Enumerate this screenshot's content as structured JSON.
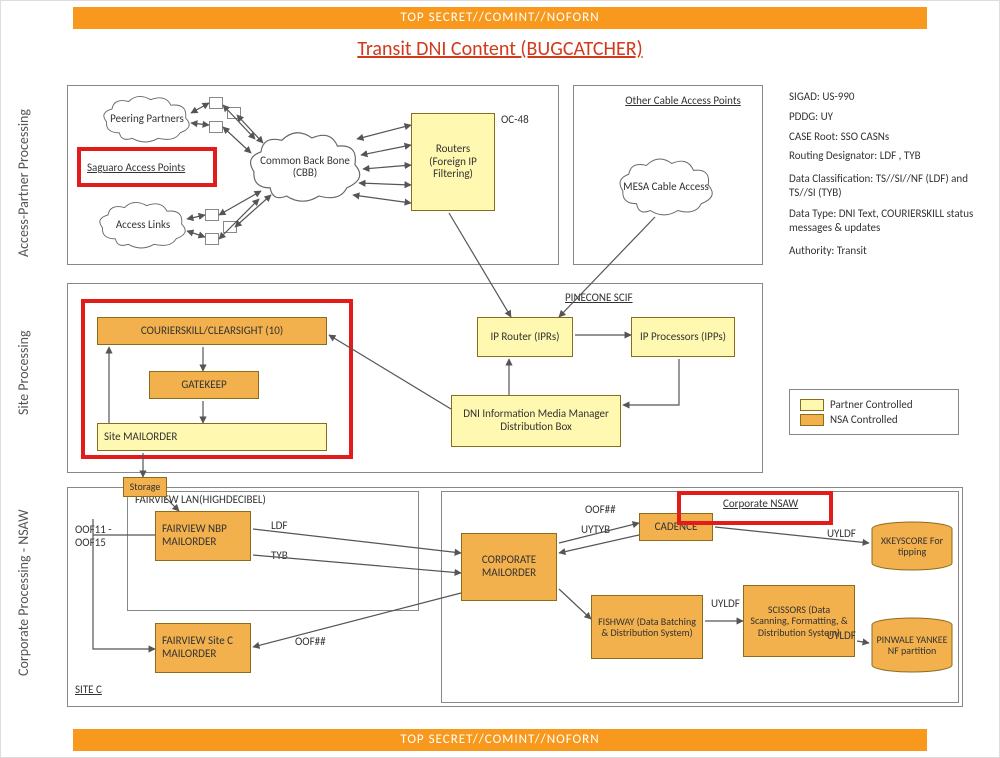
{
  "banner": "TOP SECRET//COMINT//NOFORN",
  "title": "Transit DNI Content (BUGCATCHER)",
  "sections": {
    "access": "Access-Partner Processing",
    "site": "Site Processing",
    "corp": "Corporate Processing - NSAW"
  },
  "clouds": {
    "peering": "Peering Partners",
    "access_links": "Access Links",
    "cbb": "Common Back Bone (CBB)",
    "mesa": "MESA Cable Access"
  },
  "labels": {
    "saguaro": "Saguaro Access Points",
    "other_cable": "Other Cable Access Points",
    "oc48": "OC-48",
    "pinecone": "PINECONE SCIF",
    "fairview_lan": "FAIRVIEW LAN(HIGHDECIBEL)",
    "oof_range": "OOF11 -OOF15",
    "site_c": "SITE C",
    "corp_nsaw": "Corporate NSAW",
    "ldf": "LDF",
    "tyb": "TYB",
    "oof1": "OOF##",
    "oof2": "OOF##",
    "uytyb": "UYTYB",
    "uyldf1": "UYLDF",
    "uyldf2": "UYLDF",
    "uyldf3": "UYLDF"
  },
  "nodes": {
    "routers": "Routers (Foreign IP Filtering)",
    "courierskill": "COURIERSKILL/CLEARSIGHT (10)",
    "gatekeep": "GATEKEEP",
    "site_mailorder": "Site MAILORDER",
    "ip_router": "IP Router (IPRs)",
    "ip_proc": "IP Processors (IPPs)",
    "dni_box": "DNI  Information Media Manager Distribution Box",
    "storage": "Storage",
    "fv_nbp": "FAIRVIEW NBP MAILORDER",
    "fv_sitec": "FAIRVIEW Site C MAILORDER",
    "corp_mailorder": "CORPORATE MAILORDER",
    "cadence": "CADENCE",
    "fishway": "FISHWAY (Data Batching & Distribution System)",
    "scissors": "SCISSORS (Data Scanning, Formatting, & Distribution System)",
    "xks": "XKEYSCORE For tipping",
    "pinwale": "PINWALE YANKEE NF  partition"
  },
  "legend": {
    "partner": "Partner Controlled",
    "nsa": "NSA Controlled"
  },
  "meta": {
    "l1": "SIGAD: US-990",
    "l2": "PDDG: UY",
    "l3": "CASE Root: SSO CASNs",
    "l4": "Routing Designator: LDF , TYB",
    "l5": "Data Classification: TS//SI//NF (LDF) and TS//SI (TYB)",
    "l6": "Data Type: DNI Text, COURIERSKILL status messages & updates",
    "l7": "Authority:  Transit"
  }
}
